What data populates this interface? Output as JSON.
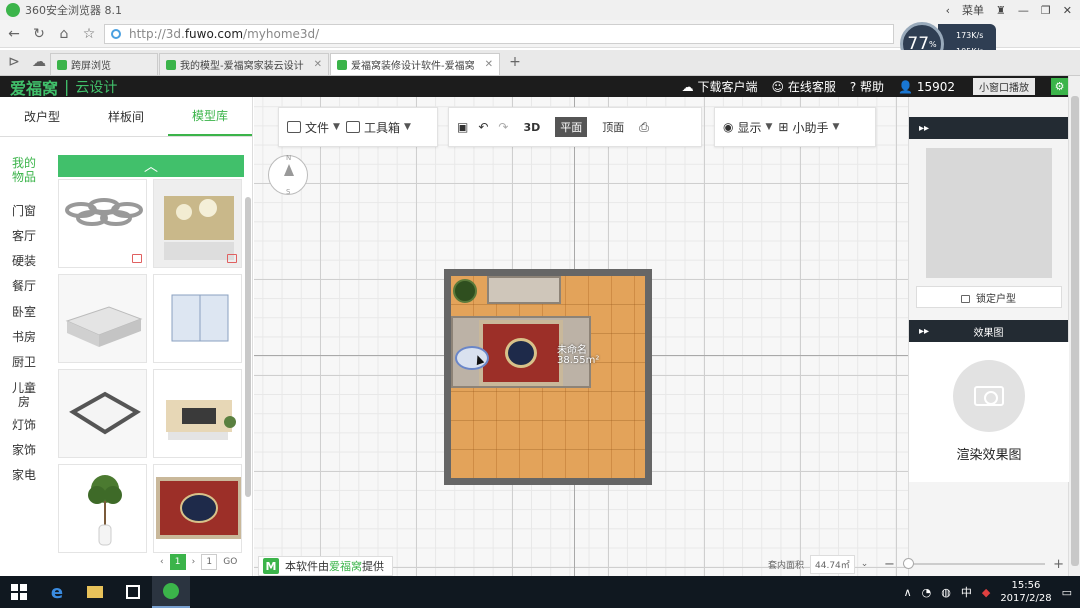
{
  "browser": {
    "title": "360安全浏览器 8.1",
    "menu_label": "菜单",
    "url_prefix": "http://3d.",
    "url_host": "fuwo.com",
    "url_path": "/myhome3d/",
    "net": {
      "percent": "77",
      "percent_unit": "%",
      "down": "173K/s",
      "up": "105K/s"
    },
    "tabs": [
      {
        "label": "跨屏浏览",
        "active": false
      },
      {
        "label": "我的模型-爱福窝家装云设计",
        "active": false
      },
      {
        "label": "爱福窝装修设计软件-爱福窝",
        "active": true
      }
    ],
    "new_tab_label": "+"
  },
  "header": {
    "brand": "爱福窝",
    "brand_sub": "云设计",
    "download": "下载客户端",
    "service": "在线客服",
    "help": "帮助",
    "user": "15902",
    "mini_window": "小窗口播放"
  },
  "left_panel": {
    "tabs": [
      {
        "label": "改户型",
        "active": false
      },
      {
        "label": "样板间",
        "active": false
      },
      {
        "label": "模型库",
        "active": true
      }
    ],
    "categories": [
      {
        "label": "我的物品",
        "active": true
      },
      {
        "label": "门窗"
      },
      {
        "label": "客厅"
      },
      {
        "label": "硬装"
      },
      {
        "label": "餐厅"
      },
      {
        "label": "卧室"
      },
      {
        "label": "书房"
      },
      {
        "label": "厨卫"
      },
      {
        "label": "儿童房"
      },
      {
        "label": "灯饰"
      },
      {
        "label": "家饰"
      },
      {
        "label": "家电"
      }
    ],
    "pager": {
      "current": "1",
      "page_box": "1",
      "go": "GO"
    }
  },
  "toolbar": {
    "file": "文件",
    "toolbox": "工具箱",
    "view_3d": "3D",
    "view_plan": "平面",
    "view_top": "顶面",
    "display": "显示",
    "helper": "小助手"
  },
  "canvas": {
    "room_name": "未命名",
    "room_area": "38.55m²",
    "compass_n": "N",
    "compass_s": "S"
  },
  "credit": {
    "prefix": "本软件由",
    "brand": "爱福窝",
    "suffix": "提供"
  },
  "right_panel": {
    "lock_label": "锁定户型",
    "render_header": "效果图",
    "render_label": "渲染效果图"
  },
  "status": {
    "inner_area_label": "套内面积",
    "inner_area_value": "44.74㎡"
  },
  "taskbar": {
    "time": "15:56",
    "date": "2017/2/28",
    "ime": "中"
  },
  "colors": {
    "accent": "#3bb44a",
    "header_bg": "#1c1c1c",
    "panel_dark": "#232b33"
  }
}
